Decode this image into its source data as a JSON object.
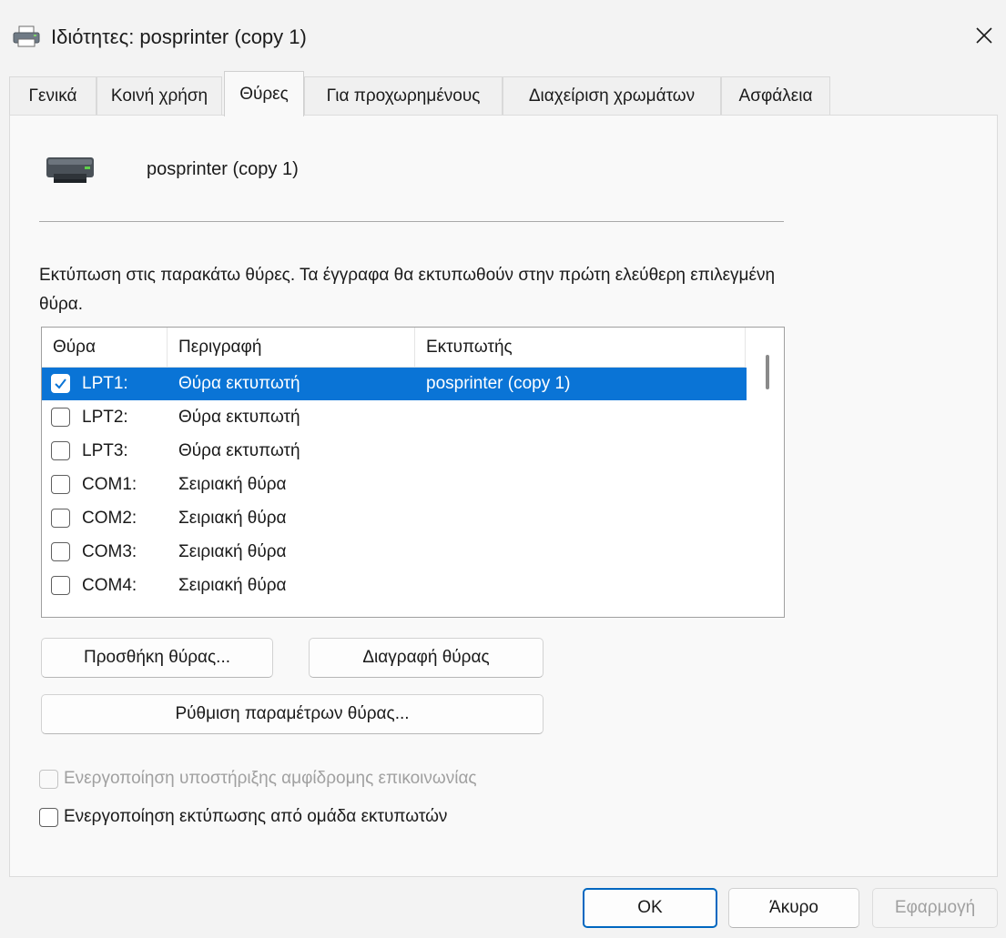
{
  "window": {
    "title": "Ιδιότητες: posprinter (copy 1)",
    "close_icon": "close-icon"
  },
  "tabs": [
    {
      "label": "Γενικά",
      "active": false
    },
    {
      "label": "Κοινή χρήση",
      "active": false
    },
    {
      "label": "Θύρες",
      "active": true
    },
    {
      "label": "Για προχωρημένους",
      "active": false
    },
    {
      "label": "Διαχείριση χρωμάτων",
      "active": false
    },
    {
      "label": "Ασφάλεια",
      "active": false
    }
  ],
  "printer": {
    "name": "posprinter (copy 1)",
    "icon": "printer-icon"
  },
  "description": "Εκτύπωση στις παρακάτω θύρες. Τα έγγραφα θα εκτυπωθούν στην πρώτη ελεύθερη επιλεγμένη θύρα.",
  "ports_table": {
    "columns": [
      "Θύρα",
      "Περιγραφή",
      "Εκτυπωτής"
    ],
    "rows": [
      {
        "port": "LPT1:",
        "description": "Θύρα εκτυπωτή",
        "printer": "posprinter (copy 1)",
        "checked": true,
        "selected": true
      },
      {
        "port": "LPT2:",
        "description": "Θύρα εκτυπωτή",
        "printer": "",
        "checked": false,
        "selected": false
      },
      {
        "port": "LPT3:",
        "description": "Θύρα εκτυπωτή",
        "printer": "",
        "checked": false,
        "selected": false
      },
      {
        "port": "COM1:",
        "description": "Σειριακή θύρα",
        "printer": "",
        "checked": false,
        "selected": false
      },
      {
        "port": "COM2:",
        "description": "Σειριακή θύρα",
        "printer": "",
        "checked": false,
        "selected": false
      },
      {
        "port": "COM3:",
        "description": "Σειριακή θύρα",
        "printer": "",
        "checked": false,
        "selected": false
      },
      {
        "port": "COM4:",
        "description": "Σειριακή θύρα",
        "printer": "",
        "checked": false,
        "selected": false
      }
    ]
  },
  "buttons": {
    "add_port": "Προσθήκη θύρας...",
    "delete_port": "Διαγραφή θύρας",
    "configure_port": "Ρύθμιση παραμέτρων θύρας..."
  },
  "options": {
    "bidirectional": {
      "label": "Ενεργοποίηση υποστήριξης αμφίδρομης επικοινωνίας",
      "checked": false,
      "enabled": false
    },
    "pooling": {
      "label": "Ενεργοποίηση εκτύπωσης από ομάδα εκτυπωτών",
      "checked": false,
      "enabled": true
    }
  },
  "footer": {
    "ok": "OK",
    "cancel": "Άκυρο",
    "apply": "Εφαρμογή"
  },
  "colors": {
    "selection": "#0a74d6",
    "default_button_border": "#0067c0"
  }
}
